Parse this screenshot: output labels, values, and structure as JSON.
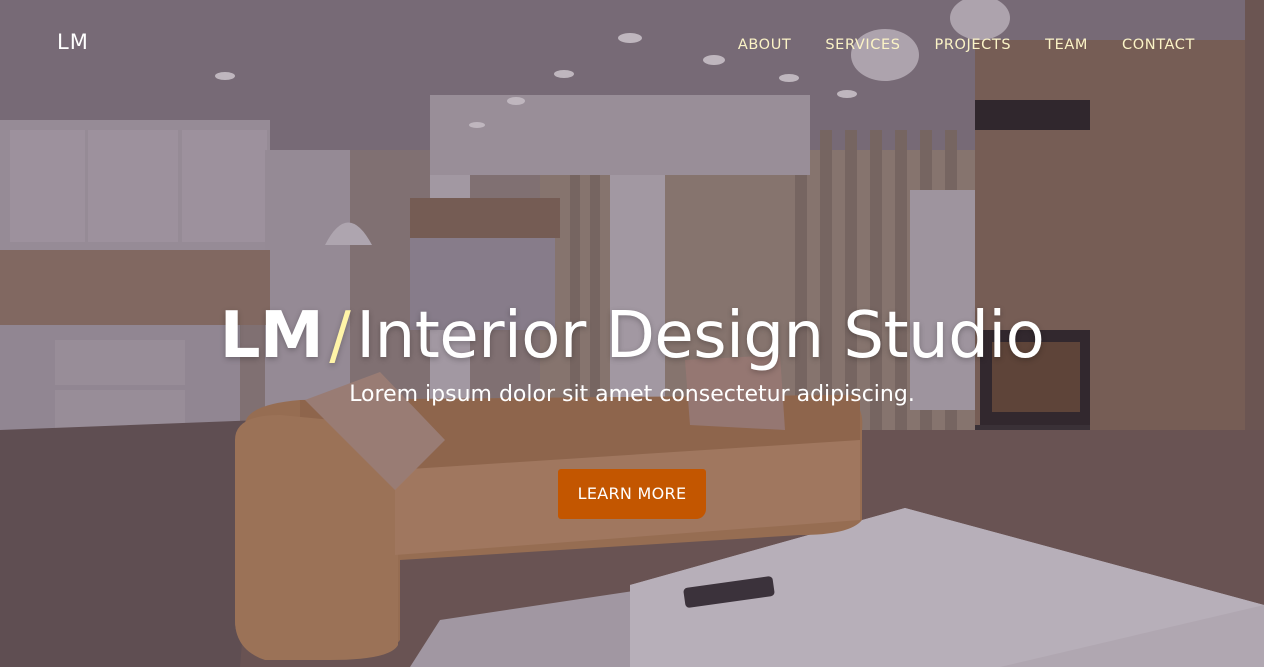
{
  "brand": {
    "name": "LM"
  },
  "nav": {
    "items": [
      {
        "label": "ABOUT"
      },
      {
        "label": "SERVICES"
      },
      {
        "label": "PROJECTS"
      },
      {
        "label": "TEAM"
      },
      {
        "label": "CONTACT"
      }
    ]
  },
  "hero": {
    "title_strong": "LM",
    "title_slash": "/",
    "title_rest": "Interior Design Studio",
    "subtitle": "Lorem ipsum dolor sit amet consectetur adipiscing.",
    "cta_label": "LEARN MORE"
  },
  "colors": {
    "accent": "#c35600",
    "nav_link": "#fbf3c6",
    "slash": "#fff4a8",
    "overlay": "#3c2d46"
  }
}
